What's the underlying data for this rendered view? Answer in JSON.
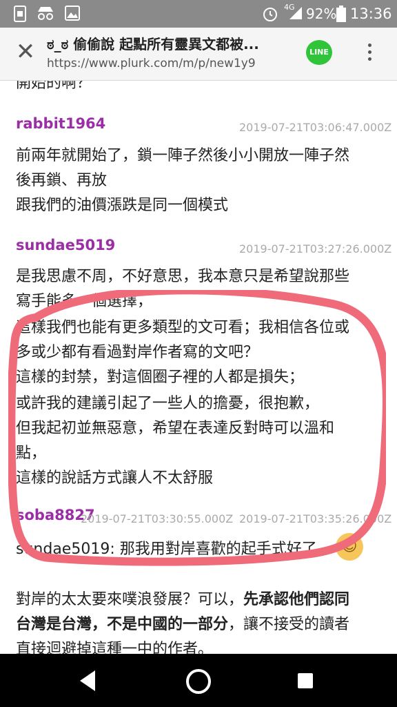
{
  "status": {
    "left_icons": [
      "sim-icon",
      "incognito-icon",
      "gallery-icon"
    ],
    "network": "4G",
    "battery": "92%",
    "time": "13:36"
  },
  "urlbar": {
    "title": "ಠ_ಠ 偷偷說 起點所有靈異文都被...",
    "url": "https://www.plurk.com/m/p/new1y9",
    "line_label": "LINE"
  },
  "partial_top": "開始的啊？",
  "responses": [
    {
      "user": "rabbit1964",
      "time": "2019-07-21T03:06:47.000Z",
      "lines": [
        "前兩年就開始了，鎖一陣子然後小小開放一陣子然",
        "後再鎖、再放",
        "跟我們的油價漲跌是同一個模式"
      ]
    },
    {
      "user": "sundae5019",
      "time": "2019-07-21T03:27:26.000Z",
      "lines": [
        "是我思慮不周，不好意思，我本意只是希望說那些",
        "寫手能多一個選擇，",
        "這樣我們也能有更多類型的文可看；我相信各位或",
        "多或少都有看過對岸作者寫的文吧？",
        "這樣的封禁，對這個圈子裡的人都是損失；",
        "或許我的建議引起了一些人的擔憂，很抱歉，",
        "但我起初並無惡意，希望在表達反對時可以溫和",
        "點，",
        "這樣的說話方式讓人不太舒服"
      ]
    },
    {
      "user": "soba8827",
      "time_a": "2019-07-21T03:30:55.000Z",
      "time_b": "2019-07-21T03:35:26.000Z",
      "reply": "sundae5019: 那我用對岸喜歡的起手式好了",
      "para_1_pre": "對岸的太太要來噗浪發展？可以，",
      "para_1_bold": "先承認他們認同",
      "para_2_bold": "台灣是台灣，不是中國的一部分",
      "para_2_post": "，讓不接受的讀者",
      "para_3": "直接迴避掉這種一中的作者。"
    }
  ],
  "annotation_color": "#f06b7a"
}
